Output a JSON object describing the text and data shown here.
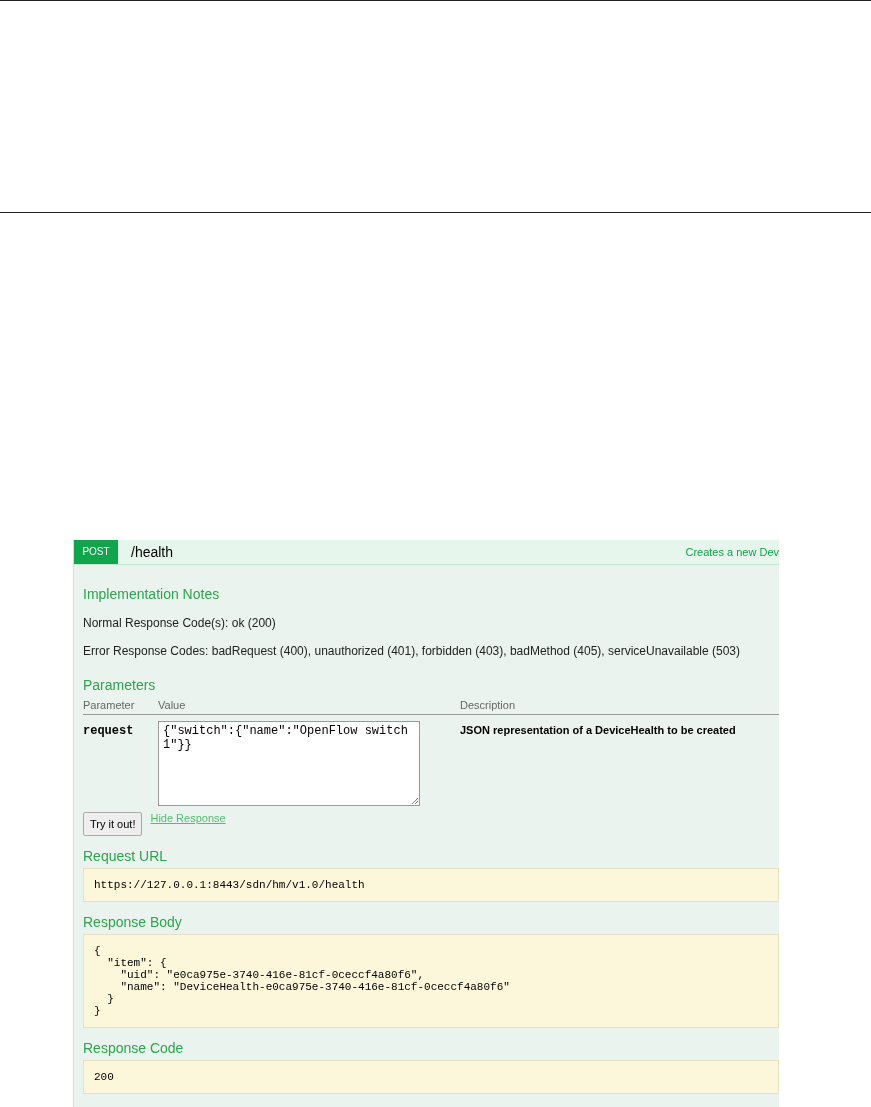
{
  "operation": {
    "method": "POST",
    "path": "/health",
    "summary": "Creates a new Dev"
  },
  "implementation_notes": {
    "title": "Implementation Notes",
    "normal": "Normal Response Code(s): ok (200)",
    "errors": "Error Response Codes: badRequest (400), unauthorized (401), forbidden (403), badMethod (405), serviceUnavailable (503)"
  },
  "parameters": {
    "title": "Parameters",
    "columns": [
      "Parameter",
      "Value",
      "Description"
    ],
    "rows": [
      {
        "name": "request",
        "value": "{\"switch\":{\"name\":\"OpenFlow switch 1\"}}",
        "description": "JSON representation of a DeviceHealth to be created"
      }
    ]
  },
  "try_button": "Try it out!",
  "hide_link": "Hide Response",
  "sections": [
    {
      "title": "Request URL",
      "lines": [
        "https://127.0.0.1:8443/sdn/hm/v1.0/health"
      ]
    },
    {
      "title": "Response Body",
      "lines": [
        "{",
        "  \"item\": {",
        "    \"uid\": \"e0ca975e-3740-416e-81cf-0ceccf4a80f6\",",
        "    \"name\": \"DeviceHealth-e0ca975e-3740-416e-81cf-0ceccf4a80f6\"",
        "  }",
        "}"
      ]
    },
    {
      "title": "Response Code",
      "lines": [
        "200"
      ]
    }
  ]
}
